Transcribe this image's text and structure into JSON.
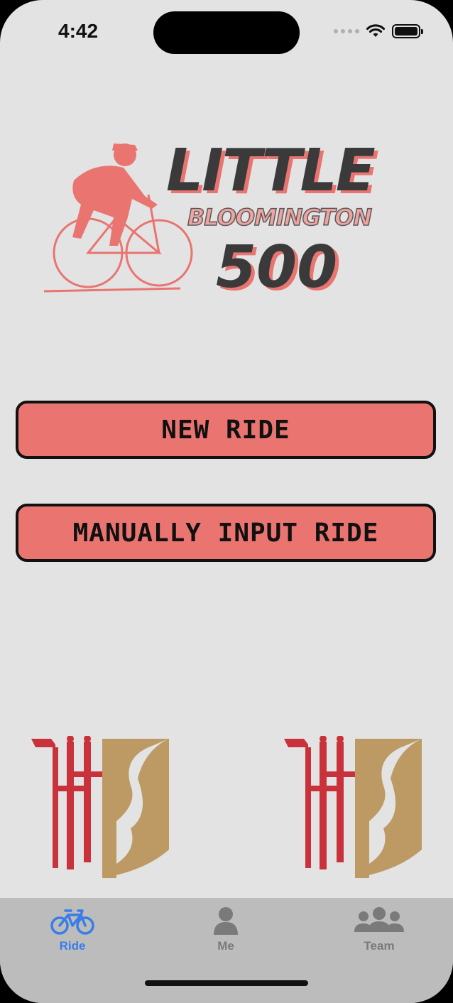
{
  "status_bar": {
    "time": "4:42"
  },
  "logo": {
    "line1": "LITTLE",
    "line2": "BLOOMINGTON",
    "line3": "500"
  },
  "actions": {
    "new_ride_label": "NEW RIDE",
    "manual_ride_label": "MANUALLY INPUT RIDE"
  },
  "tabbar": {
    "active_tab": "Ride",
    "tabs": [
      {
        "label": "Ride",
        "icon": "bicycle-icon"
      },
      {
        "label": "Me",
        "icon": "person-icon"
      },
      {
        "label": "Team",
        "icon": "group-icon"
      }
    ]
  },
  "colors": {
    "background": "#e3e3e3",
    "button_fill": "#ea7570",
    "accent": "#3a7de6",
    "tab_inactive": "#7a7a7a",
    "shield_red": "#c9323a",
    "shield_gold": "#bd9a64"
  }
}
